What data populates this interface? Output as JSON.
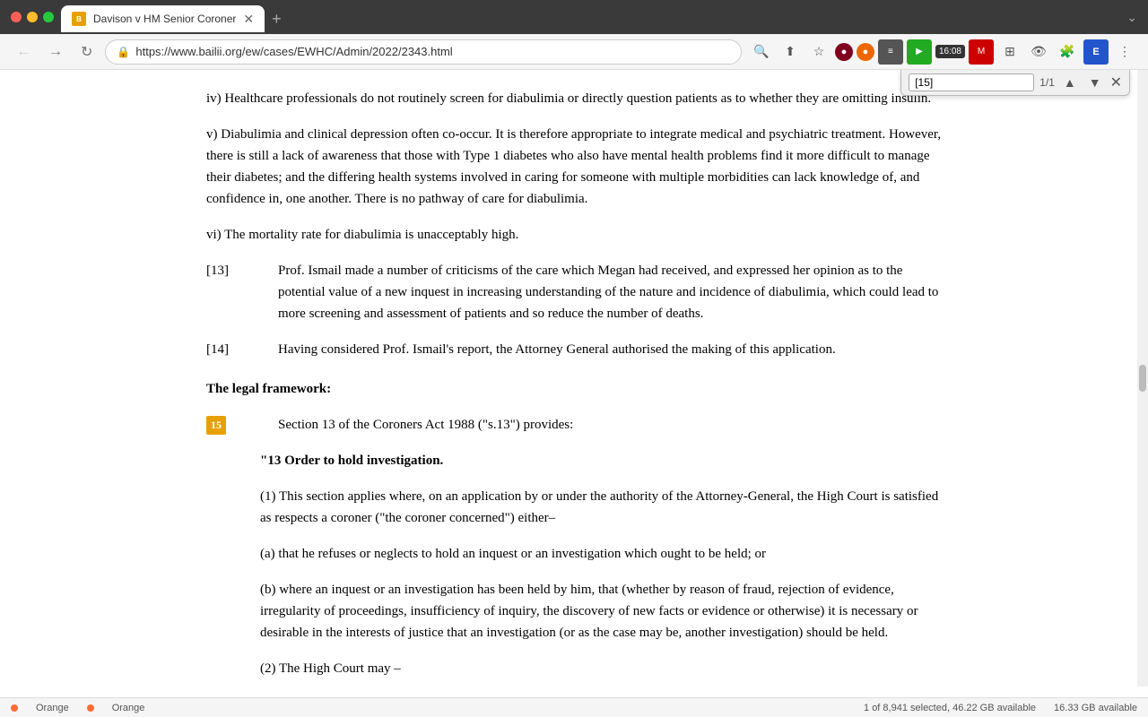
{
  "browser": {
    "tab_title": "Davison v HM Senior Coroner",
    "url": "https://www.bailii.org/ew/cases/EWHC/Admin/2022/2343.html",
    "time": "16:08",
    "new_tab_label": "+"
  },
  "find_bar": {
    "query": "[15]",
    "count": "1/1",
    "up_label": "▲",
    "down_label": "▼",
    "close_label": "✕"
  },
  "content": {
    "para_iv": "iv) Healthcare professionals do not routinely screen for diabulimia or directly question patients as to whether they are omitting insulin.",
    "para_v": "v) Diabulimia and clinical depression often co-occur. It is therefore appropriate to integrate medical and psychiatric treatment. However, there is still a lack of awareness that those with Type 1 diabetes who also have mental health problems find it more difficult to manage their diabetes; and the differing health systems involved in caring for someone with multiple morbidities can lack knowledge of, and confidence in, one another. There is no pathway of care for diabulimia.",
    "para_vi": "vi) The mortality rate for diabulimia is unacceptably high.",
    "para_13_num": "[13]",
    "para_13_text": "Prof. Ismail made a number of criticisms of the care which Megan had received, and expressed her opinion as to the potential value of a new inquest in increasing understanding of the nature and incidence of diabulimia, which could lead to more screening and assessment of patients and so reduce the number of deaths.",
    "para_14_num": "[14]",
    "para_14_text": "Having considered Prof. Ismail's report, the Attorney General authorised the making of this application.",
    "heading_legal": "The legal framework:",
    "para_15_num": "15",
    "para_15_text": "Section 13 of the Coroners Act 1988 (\"s.13\") provides:",
    "quote_heading": "\"13 Order to hold investigation.",
    "quote_1": "(1) This section applies where, on an application by or under the authority of the Attorney-General, the High Court is satisfied as respects a coroner (\"the coroner concerned\") either–",
    "quote_a": "(a) that he refuses or neglects to hold an inquest or an investigation which ought to be held; or",
    "quote_b": "(b) where an inquest or an investigation has been held by him, that (whether by reason of fraud, rejection of evidence, irregularity of proceedings, insufficiency of inquiry, the discovery of new facts or evidence or otherwise) it is necessary or desirable in the interests of justice that an investigation (or as the case may be, another investigation) should be held.",
    "quote_2": "(2) The High Court may –"
  },
  "status_bar": {
    "text": "1 of 8,941 selected, 46.22 GB available",
    "storage": "16.33 GB available",
    "dot1_color": "#ff6b35",
    "dot2_color": "#ff6b35",
    "label1": "Orange",
    "label2": "Orange"
  }
}
